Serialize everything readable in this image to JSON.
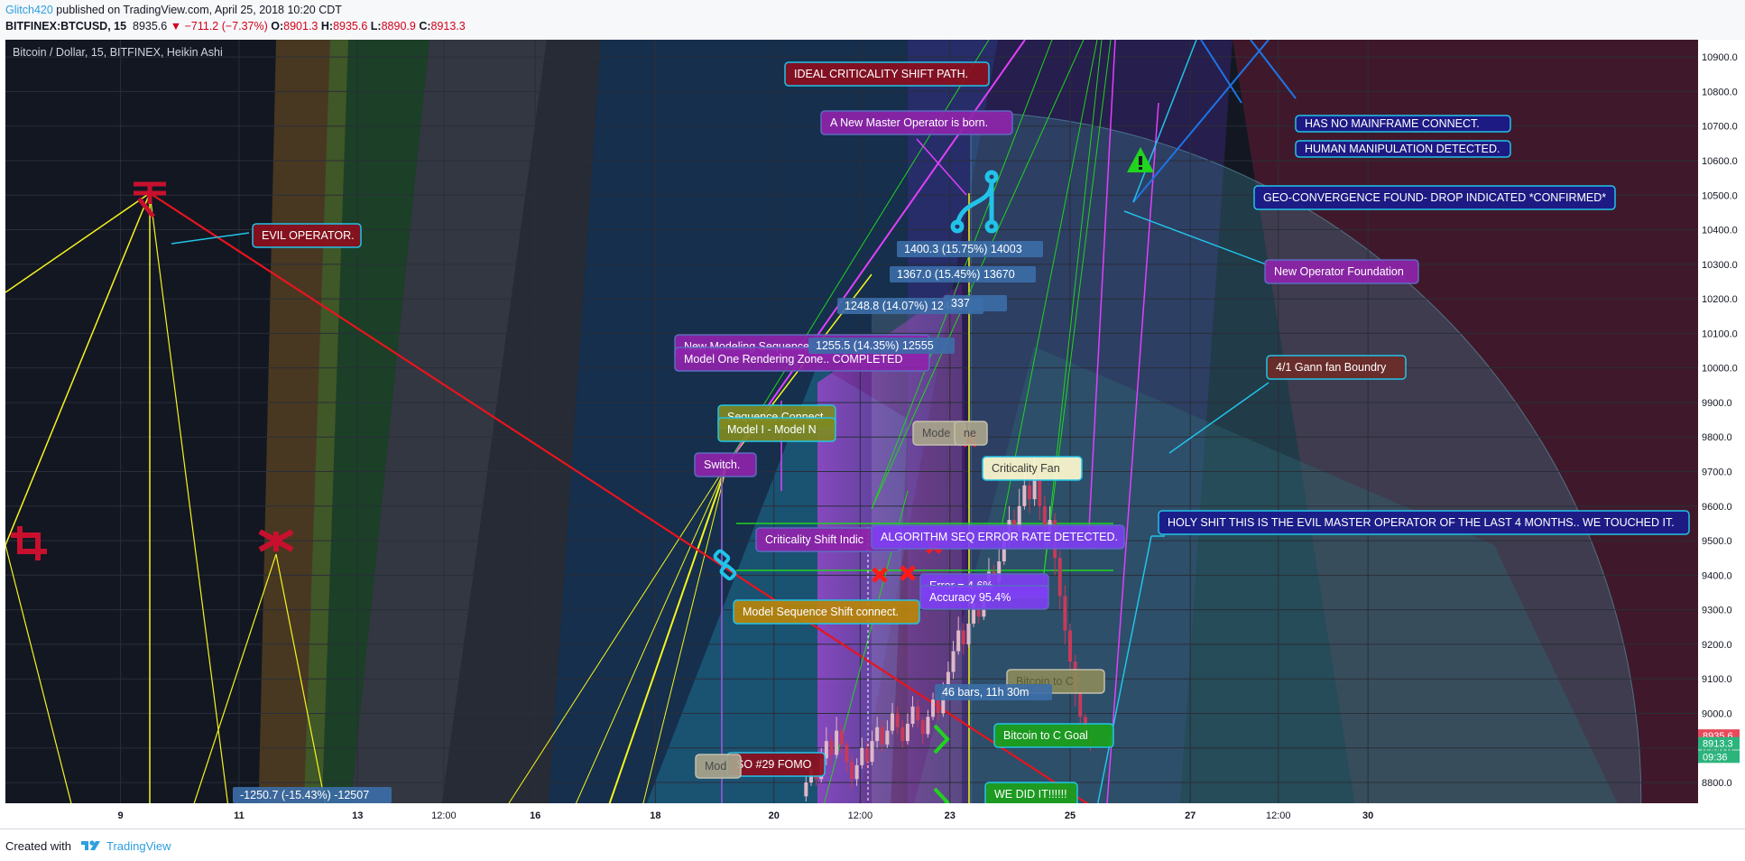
{
  "header": {
    "author": "Glitch420",
    "published": " published on TradingView.com, April 25, 2018 10:20 CDT",
    "symbol": "BITFINEX:BTCUSD, 15",
    "price": "8935.6",
    "change": "▼ −711.2 (−7.37%)",
    "o_label": "O:",
    "o_value": "8901.3",
    "h_label": "H:",
    "h_value": "8935.6",
    "l_label": "L:",
    "l_value": "8890.9",
    "c_label": "C:",
    "c_value": "8913.3"
  },
  "footer": {
    "created_with": "Created with",
    "brand": "TradingView"
  },
  "colors": {
    "background": "#131722",
    "axis_bg": "#ffffff",
    "axis_text": "#131722",
    "candle_up": "#e0b8c8",
    "candle_down": "#c73a5a",
    "fan_yellow": "#f5f51e",
    "trend_red": "#e8141e",
    "magenta": "#e040fb",
    "green": "#21d41e",
    "cyan": "#22c3e8",
    "blue": "#1e74e8"
  },
  "chart_data": {
    "type": "candlestick",
    "title": "Bitcoin / Dollar, 15, BITFINEX, Heikin Ashi",
    "ylim": [
      8740,
      10950
    ],
    "ylabel": "",
    "y_ticks": [
      "8800.0",
      "8900.0",
      "9000.0",
      "9100.0",
      "9200.0",
      "9300.0",
      "9400.0",
      "9500.0",
      "9600.0",
      "9700.0",
      "9800.0",
      "9900.0",
      "10000.0",
      "10100.0",
      "10200.0",
      "10300.0",
      "10400.0",
      "10500.0",
      "10600.0",
      "10700.0",
      "10800.0",
      "10900.0"
    ],
    "x_ticks": [
      {
        "label": "9",
        "pos": 0.068
      },
      {
        "label": "11",
        "pos": 0.138
      },
      {
        "label": "13",
        "pos": 0.208
      },
      {
        "label": "12:00",
        "pos": 0.259
      },
      {
        "label": "16",
        "pos": 0.313
      },
      {
        "label": "18",
        "pos": 0.384
      },
      {
        "label": "20",
        "pos": 0.454
      },
      {
        "label": "12:00",
        "pos": 0.505
      },
      {
        "label": "23",
        "pos": 0.558
      },
      {
        "label": "25",
        "pos": 0.629
      },
      {
        "label": "27",
        "pos": 0.7
      },
      {
        "label": "12:00",
        "pos": 0.752
      },
      {
        "label": "30",
        "pos": 0.805
      }
    ],
    "price_labels": [
      {
        "value": 8935.6,
        "text": "8935.6",
        "color": "#e8495b"
      },
      {
        "value": 8913.3,
        "text": "8913.3",
        "color": "#2cb47d"
      },
      {
        "value": 8875,
        "text": "09:36",
        "color": "#2cb47d"
      }
    ],
    "measure_labels": [
      {
        "text": "1400.3 (15.75%) 14003"
      },
      {
        "text": "1367.0 (15.45%) 13670"
      },
      {
        "text": "1248.8 (14.07%) 12483"
      },
      {
        "text": "1255.5 (14.35%) 12555"
      },
      {
        "text": "-1250.7 (-15.43%) -12507"
      },
      {
        "text": "46 bars, 11h 30m"
      },
      {
        "text": "337"
      }
    ],
    "callouts": [
      {
        "text": "IDEAL CRITICALITY SHIFT  PATH.",
        "style": "red"
      },
      {
        "text": "A New Master Operator is born.",
        "style": "purple"
      },
      {
        "text": "EVIL OPERATOR.",
        "style": "red"
      },
      {
        "text": "HAS NO MAINFRAME CONNECT.",
        "style": "navy"
      },
      {
        "text": "HUMAN MANIPULATION DETECTED.",
        "style": "navy"
      },
      {
        "text": "GEO-CONVERGENCE FOUND- DROP INDICATED *CONFIRMED*",
        "style": "navy"
      },
      {
        "text": "New Operator Foundation",
        "style": "purple"
      },
      {
        "text": "4/1 Gann fan Boundry",
        "style": "brown"
      },
      {
        "text": "New Modeling Sequence",
        "style": "purple"
      },
      {
        "text": "Model One Rendering Zone..  COMPLETED",
        "style": "purple"
      },
      {
        "text": "Sequence Connect",
        "style": "olive"
      },
      {
        "text": "Model I - Model N",
        "style": "olive"
      },
      {
        "text": "Switch.",
        "style": "purple"
      },
      {
        "text": "Criticality Shift Indic",
        "style": "purple"
      },
      {
        "text": "ALGORITHM SEQ ERROR RATE DETECTED.",
        "style": "violet"
      },
      {
        "text": "Error = 4.6%",
        "style": "violet"
      },
      {
        "text": "Accuracy  95.4%",
        "style": "violet"
      },
      {
        "text": "Model Sequence Shift connect.",
        "style": "gold"
      },
      {
        "text": "Criticality Fan",
        "style": "cream"
      },
      {
        "text": "Mode",
        "style": "grey"
      },
      {
        "text": "ne",
        "style": "grey"
      },
      {
        "text": "Bitcoin to C",
        "style": "khaki"
      },
      {
        "text": "Bitcoin to C Goal",
        "style": "green"
      },
      {
        "text": "WE DID IT!!!!!!",
        "style": "green"
      },
      {
        "text": "SO #29 FOMO",
        "style": "red"
      },
      {
        "text": "Mod",
        "style": "grey"
      },
      {
        "text": "HOLY SHIT THIS IS THE EVIL MASTER OPERATOR OF THE LAST 4 MONTHS.. WE TOUCHED IT.",
        "style": "navy"
      }
    ],
    "candles": [
      {
        "x": 0.473,
        "o": 8760,
        "c": 8800,
        "h": 8820,
        "l": 8745
      },
      {
        "x": 0.476,
        "o": 8800,
        "c": 8840,
        "h": 8860,
        "l": 8790
      },
      {
        "x": 0.479,
        "o": 8840,
        "c": 8810,
        "h": 8870,
        "l": 8790
      },
      {
        "x": 0.482,
        "o": 8810,
        "c": 8870,
        "h": 8900,
        "l": 8800
      },
      {
        "x": 0.485,
        "o": 8870,
        "c": 8920,
        "h": 8960,
        "l": 8850
      },
      {
        "x": 0.488,
        "o": 8920,
        "c": 8880,
        "h": 8940,
        "l": 8850
      },
      {
        "x": 0.491,
        "o": 8880,
        "c": 8950,
        "h": 8990,
        "l": 8870
      },
      {
        "x": 0.494,
        "o": 8950,
        "c": 8910,
        "h": 8970,
        "l": 8880
      },
      {
        "x": 0.497,
        "o": 8910,
        "c": 8860,
        "h": 8920,
        "l": 8830
      },
      {
        "x": 0.5,
        "o": 8860,
        "c": 8810,
        "h": 8880,
        "l": 8780
      },
      {
        "x": 0.503,
        "o": 8810,
        "c": 8850,
        "h": 8870,
        "l": 8790
      },
      {
        "x": 0.506,
        "o": 8850,
        "c": 8900,
        "h": 8930,
        "l": 8840
      },
      {
        "x": 0.509,
        "o": 8900,
        "c": 8860,
        "h": 8920,
        "l": 8840
      },
      {
        "x": 0.512,
        "o": 8860,
        "c": 8920,
        "h": 8950,
        "l": 8850
      },
      {
        "x": 0.515,
        "o": 8920,
        "c": 8960,
        "h": 8990,
        "l": 8900
      },
      {
        "x": 0.518,
        "o": 8960,
        "c": 8910,
        "h": 8980,
        "l": 8890
      },
      {
        "x": 0.521,
        "o": 8910,
        "c": 8950,
        "h": 8980,
        "l": 8900
      },
      {
        "x": 0.524,
        "o": 8950,
        "c": 9000,
        "h": 9030,
        "l": 8940
      },
      {
        "x": 0.527,
        "o": 9000,
        "c": 8960,
        "h": 9020,
        "l": 8940
      },
      {
        "x": 0.53,
        "o": 8960,
        "c": 8920,
        "h": 8980,
        "l": 8900
      },
      {
        "x": 0.533,
        "o": 8920,
        "c": 8970,
        "h": 9000,
        "l": 8910
      },
      {
        "x": 0.536,
        "o": 8970,
        "c": 9020,
        "h": 9050,
        "l": 8960
      },
      {
        "x": 0.539,
        "o": 9020,
        "c": 8980,
        "h": 9040,
        "l": 8960
      },
      {
        "x": 0.542,
        "o": 8980,
        "c": 8940,
        "h": 8990,
        "l": 8910
      },
      {
        "x": 0.545,
        "o": 8940,
        "c": 8990,
        "h": 9010,
        "l": 8930
      },
      {
        "x": 0.548,
        "o": 8990,
        "c": 9040,
        "h": 9060,
        "l": 8980
      },
      {
        "x": 0.551,
        "o": 9040,
        "c": 9000,
        "h": 9060,
        "l": 8980
      },
      {
        "x": 0.554,
        "o": 9000,
        "c": 9060,
        "h": 9090,
        "l": 8990
      },
      {
        "x": 0.557,
        "o": 9060,
        "c": 9120,
        "h": 9150,
        "l": 9050
      },
      {
        "x": 0.56,
        "o": 9120,
        "c": 9180,
        "h": 9210,
        "l": 9100
      },
      {
        "x": 0.563,
        "o": 9180,
        "c": 9240,
        "h": 9280,
        "l": 9170
      },
      {
        "x": 0.566,
        "o": 9240,
        "c": 9200,
        "h": 9260,
        "l": 9170
      },
      {
        "x": 0.569,
        "o": 9200,
        "c": 9260,
        "h": 9300,
        "l": 9190
      },
      {
        "x": 0.572,
        "o": 9260,
        "c": 9320,
        "h": 9350,
        "l": 9250
      },
      {
        "x": 0.575,
        "o": 9320,
        "c": 9280,
        "h": 9340,
        "l": 9260
      },
      {
        "x": 0.578,
        "o": 9280,
        "c": 9350,
        "h": 9390,
        "l": 9270
      },
      {
        "x": 0.581,
        "o": 9350,
        "c": 9410,
        "h": 9450,
        "l": 9330
      },
      {
        "x": 0.584,
        "o": 9410,
        "c": 9380,
        "h": 9430,
        "l": 9350
      },
      {
        "x": 0.587,
        "o": 9380,
        "c": 9440,
        "h": 9480,
        "l": 9370
      },
      {
        "x": 0.59,
        "o": 9440,
        "c": 9500,
        "h": 9540,
        "l": 9430
      },
      {
        "x": 0.593,
        "o": 9500,
        "c": 9560,
        "h": 9600,
        "l": 9480
      },
      {
        "x": 0.596,
        "o": 9560,
        "c": 9530,
        "h": 9590,
        "l": 9500
      },
      {
        "x": 0.599,
        "o": 9530,
        "c": 9600,
        "h": 9650,
        "l": 9510
      },
      {
        "x": 0.602,
        "o": 9600,
        "c": 9660,
        "h": 9700,
        "l": 9590
      },
      {
        "x": 0.605,
        "o": 9660,
        "c": 9620,
        "h": 9710,
        "l": 9580
      },
      {
        "x": 0.608,
        "o": 9620,
        "c": 9680,
        "h": 9740,
        "l": 9600
      },
      {
        "x": 0.611,
        "o": 9680,
        "c": 9600,
        "h": 9700,
        "l": 9560
      },
      {
        "x": 0.614,
        "o": 9600,
        "c": 9520,
        "h": 9630,
        "l": 9480
      },
      {
        "x": 0.617,
        "o": 9520,
        "c": 9560,
        "h": 9600,
        "l": 9490
      },
      {
        "x": 0.62,
        "o": 9560,
        "c": 9450,
        "h": 9580,
        "l": 9400
      },
      {
        "x": 0.623,
        "o": 9450,
        "c": 9340,
        "h": 9470,
        "l": 9300
      },
      {
        "x": 0.626,
        "o": 9340,
        "c": 9240,
        "h": 9370,
        "l": 9200
      },
      {
        "x": 0.629,
        "o": 9240,
        "c": 9150,
        "h": 9260,
        "l": 9100
      },
      {
        "x": 0.632,
        "o": 9150,
        "c": 9060,
        "h": 9170,
        "l": 9020
      },
      {
        "x": 0.635,
        "o": 9060,
        "c": 8990,
        "h": 9080,
        "l": 8950
      },
      {
        "x": 0.638,
        "o": 8990,
        "c": 8930,
        "h": 9000,
        "l": 8900
      },
      {
        "x": 0.641,
        "o": 8930,
        "c": 8913,
        "h": 8936,
        "l": 8891
      }
    ],
    "grid": true,
    "legend": "none"
  }
}
